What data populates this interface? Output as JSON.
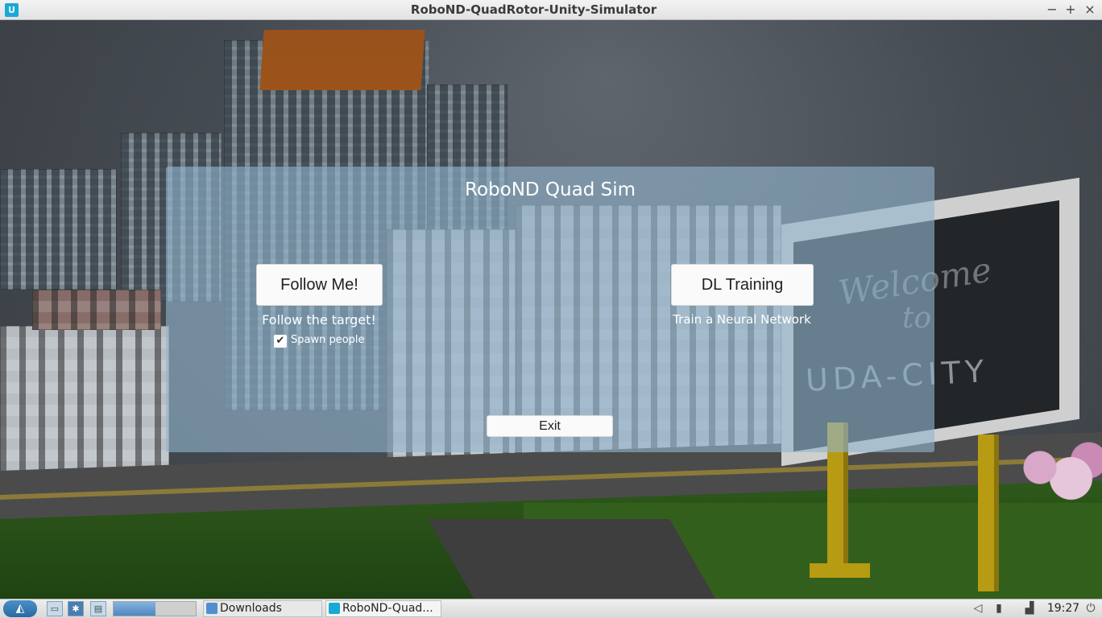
{
  "window": {
    "title": "RoboND-QuadRotor-Unity-Simulator",
    "app_icon": "udacity-icon",
    "controls": {
      "minimize": "−",
      "maximize": "+",
      "close": "×"
    }
  },
  "scene": {
    "billboard_line1": "Welcome",
    "billboard_line2": "to",
    "billboard_brand": "UDA-CITY"
  },
  "menu": {
    "title": "RoboND Quad Sim",
    "follow_button": "Follow Me!",
    "follow_caption": "Follow the target!",
    "spawn_checkbox_label": "Spawn people",
    "spawn_checked": true,
    "dl_button": "DL Training",
    "dl_caption": "Train a Neural Network",
    "exit_button": "Exit"
  },
  "taskbar": {
    "start_glyph": "◭",
    "tasks": [
      {
        "label": "Downloads",
        "icon": "folder-icon"
      },
      {
        "label": "RoboND-Quad...",
        "icon": "udacity-icon"
      }
    ],
    "clock": "19:27",
    "colors": {
      "accent": "#2a69a3",
      "panel": "#91b4cd"
    }
  }
}
